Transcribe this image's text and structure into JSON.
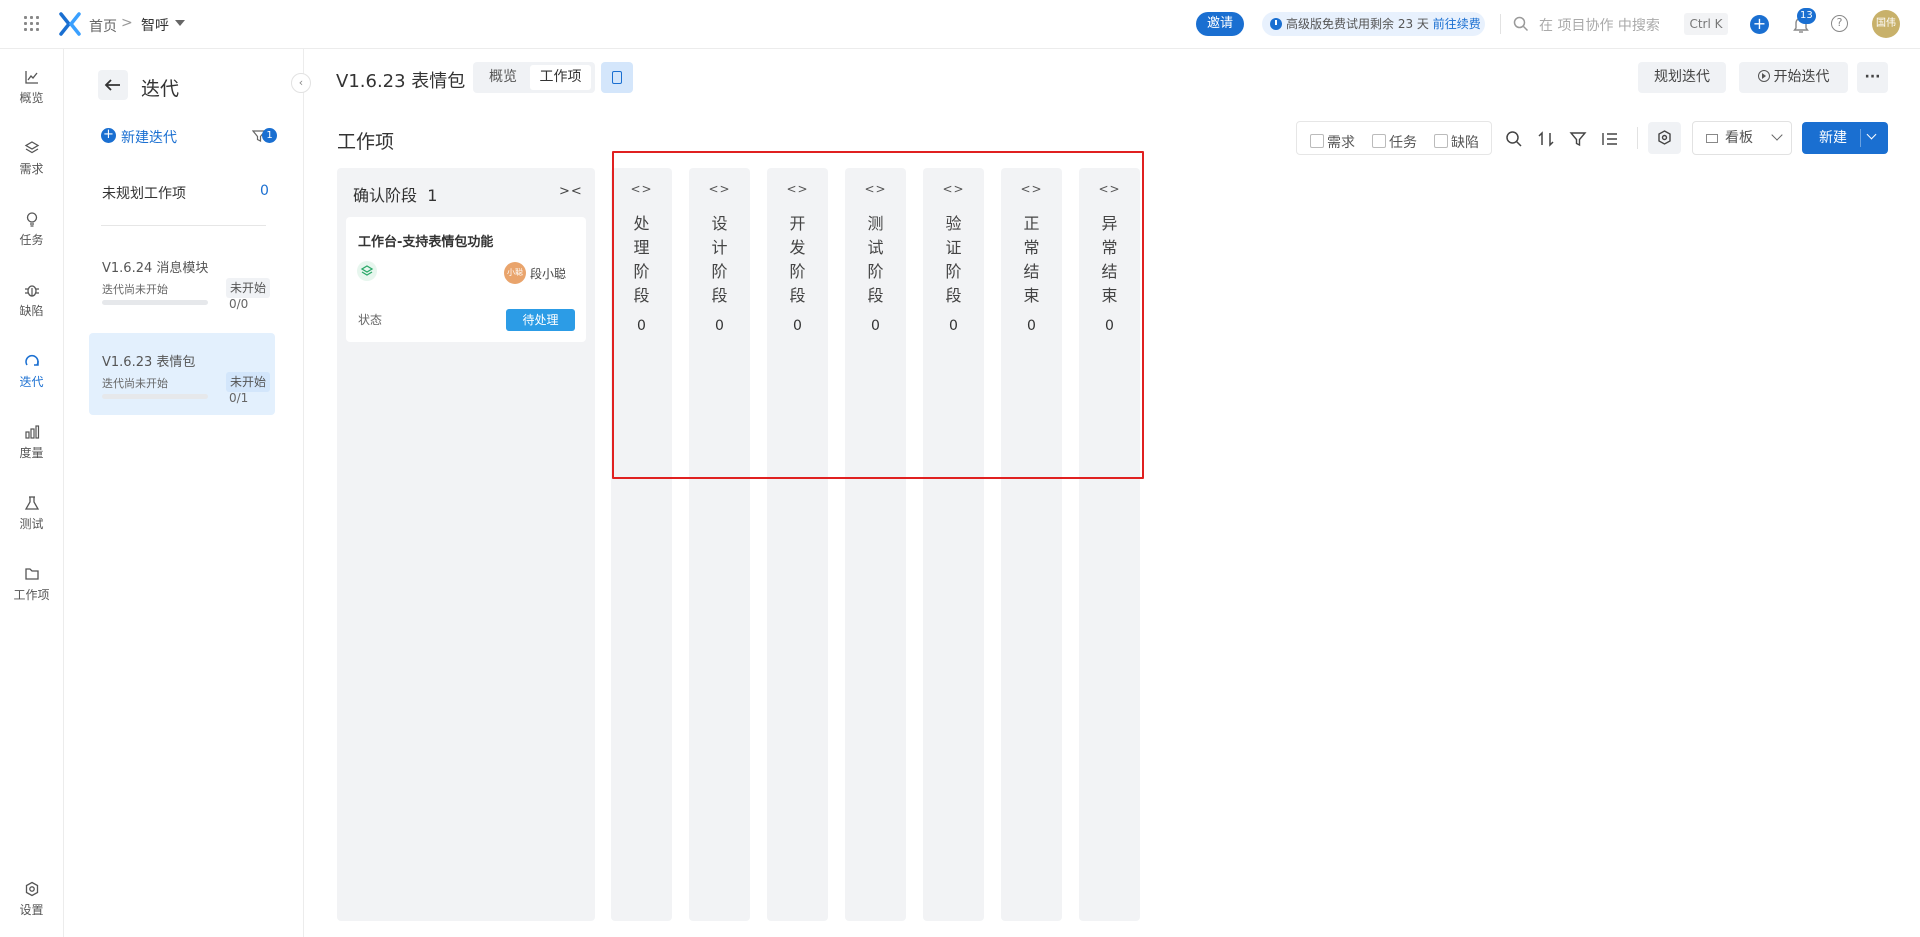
{
  "topbar": {
    "breadcrumb_home": "首页",
    "breadcrumb_sep": ">",
    "project_name": "智呼",
    "invite_label": "邀请",
    "trial_text_prefix": "高级版免费试用剩余 23 天",
    "trial_link": "前往续费",
    "search_placeholder": "在 项目协作 中搜索",
    "shortcut": "Ctrl K",
    "plus_glyph": "+",
    "notification_count": "13",
    "help_glyph": "?",
    "user_avatar_text": "国伟"
  },
  "leftnav": {
    "items": [
      {
        "label": "概览",
        "icon": "chart-line-icon"
      },
      {
        "label": "需求",
        "icon": "layers-icon"
      },
      {
        "label": "任务",
        "icon": "lightbulb-icon"
      },
      {
        "label": "缺陷",
        "icon": "bug-icon"
      },
      {
        "label": "迭代",
        "icon": "iteration-icon"
      },
      {
        "label": "度量",
        "icon": "bar-chart-icon"
      },
      {
        "label": "测试",
        "icon": "flask-icon"
      },
      {
        "label": "工作项",
        "icon": "folder-icon"
      }
    ],
    "settings_label": "设置",
    "active": "迭代"
  },
  "panel": {
    "title": "迭代",
    "new_iteration": "新建迭代",
    "filter_badge": "1",
    "unplanned_label": "未规划工作项",
    "unplanned_count": "0",
    "iterations": [
      {
        "name": "V1.6.24 消息模块",
        "status_text": "迭代尚未开始",
        "tag": "未开始",
        "ratio": "0/0",
        "progress": 0,
        "selected": false
      },
      {
        "name": "V1.6.23 表情包",
        "status_text": "迭代尚未开始",
        "tag": "未开始",
        "ratio": "0/1",
        "progress": 0,
        "selected": true
      }
    ],
    "collapse_glyph": "‹"
  },
  "header": {
    "iteration_title": "V1.6.23 表情包",
    "tabs": [
      "概览",
      "工作项"
    ],
    "active_tab": "工作项",
    "plan_btn": "规划迭代",
    "start_btn": "开始迭代",
    "more_glyph": "···"
  },
  "toolbar": {
    "section_title": "工作项",
    "filters": [
      "需求",
      "任务",
      "缺陷"
    ],
    "view_label": "看板",
    "new_label": "新建"
  },
  "board": {
    "main_column": {
      "name": "确认阶段",
      "count": "1",
      "fold_glyph": "><",
      "card": {
        "title": "工作台-支持表情包功能",
        "assignee_avatar": "小聪",
        "assignee": "段小聪",
        "status_label": "状态",
        "status_value": "待处理"
      }
    },
    "expand_glyph": "<>",
    "collapsed_columns": [
      {
        "chars": [
          "处",
          "理",
          "阶",
          "段"
        ],
        "count": "0"
      },
      {
        "chars": [
          "设",
          "计",
          "阶",
          "段"
        ],
        "count": "0"
      },
      {
        "chars": [
          "开",
          "发",
          "阶",
          "段"
        ],
        "count": "0"
      },
      {
        "chars": [
          "测",
          "试",
          "阶",
          "段"
        ],
        "count": "0"
      },
      {
        "chars": [
          "验",
          "证",
          "阶",
          "段"
        ],
        "count": "0"
      },
      {
        "chars": [
          "正",
          "常",
          "结",
          "束"
        ],
        "count": "0"
      },
      {
        "chars": [
          "异",
          "常",
          "结",
          "束"
        ],
        "count": "0"
      }
    ]
  },
  "colors": {
    "accent": "#1a6fd1",
    "status_blue": "#2c9ce6",
    "column_bg": "#f2f3f5",
    "highlight": "#e02020"
  }
}
